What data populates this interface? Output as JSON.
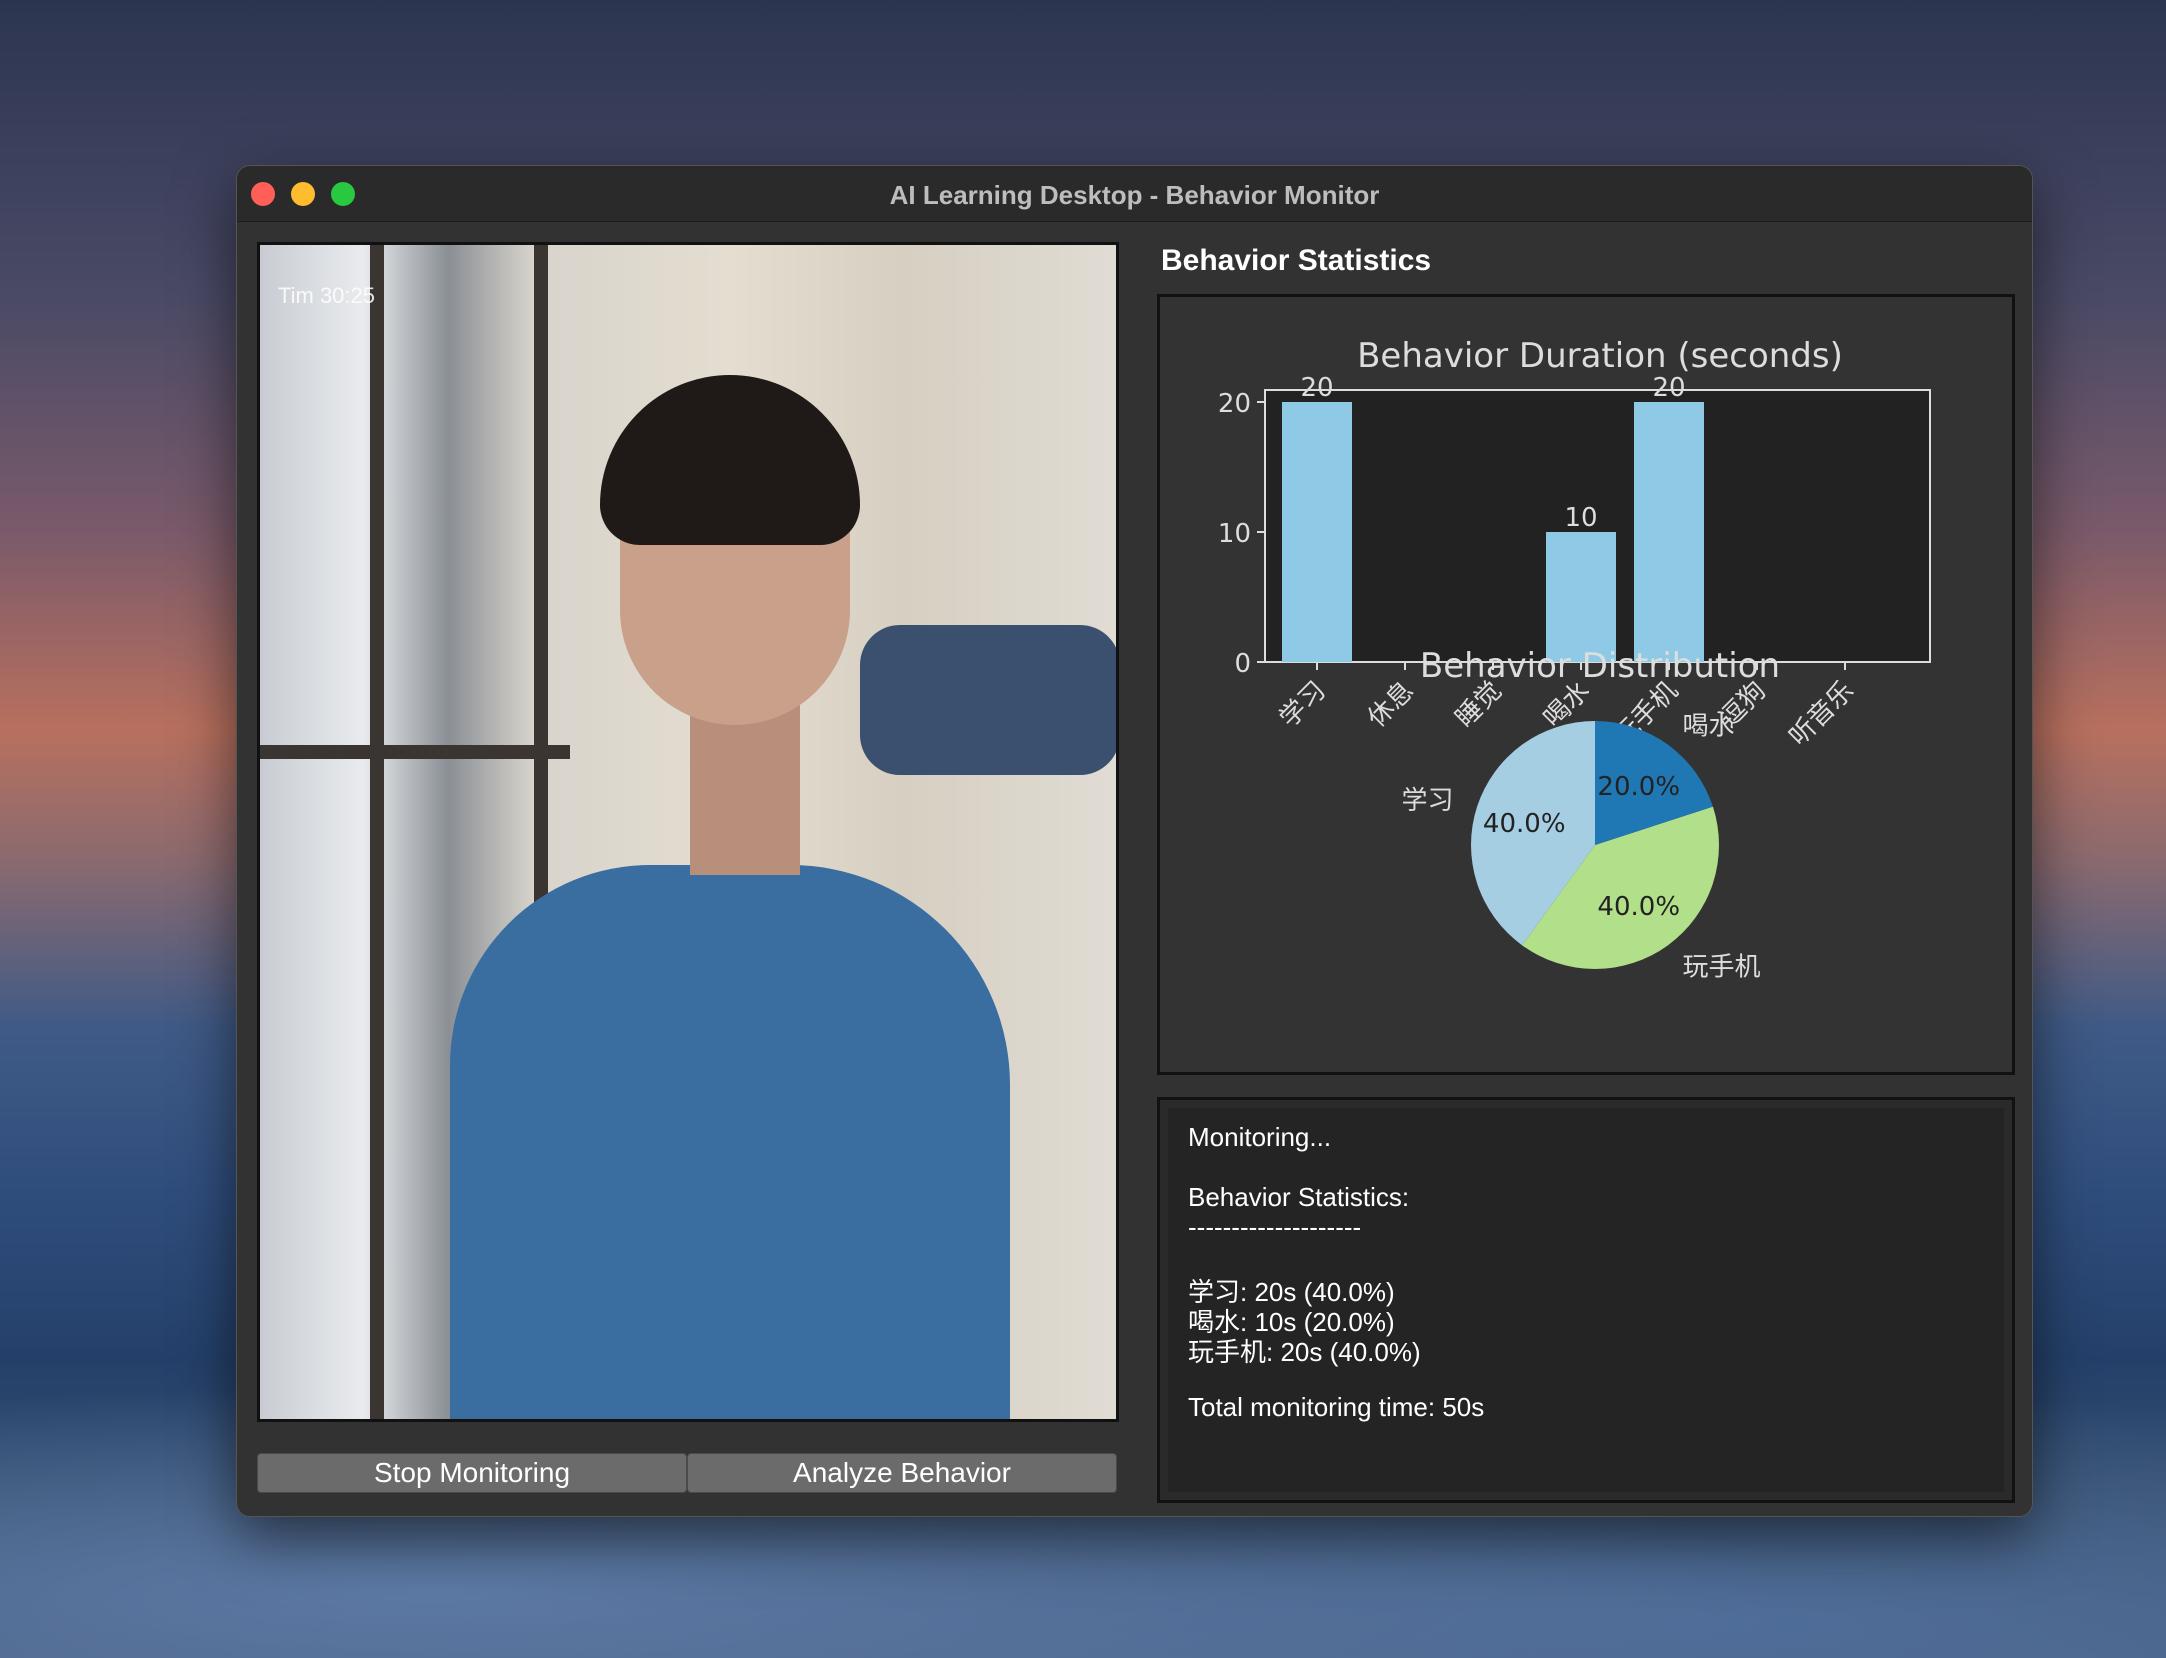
{
  "window": {
    "title": "AI Learning Desktop - Behavior Monitor"
  },
  "video": {
    "overlay_text": "Tim   30:25"
  },
  "buttons": {
    "stop": "Stop Monitoring",
    "analyze": "Analyze Behavior"
  },
  "stats_panel": {
    "title": "Behavior Statistics"
  },
  "chart_data": [
    {
      "type": "bar",
      "title": "Behavior Duration (seconds)",
      "categories": [
        "学习",
        "休息",
        "睡觉",
        "喝水",
        "玩手机",
        "逗狗",
        "听音乐"
      ],
      "values": [
        20,
        0,
        0,
        10,
        20,
        0,
        0
      ],
      "data_labels": [
        "20",
        "",
        "",
        "10",
        "20",
        "",
        ""
      ],
      "yticks": [
        "0",
        "10",
        "20"
      ],
      "ylim": [
        0,
        20
      ],
      "bar_color": "#8ecae6"
    },
    {
      "type": "pie",
      "title": "Behavior Distribution",
      "labels": [
        "学习",
        "玩手机",
        "喝水"
      ],
      "values": [
        40.0,
        40.0,
        20.0
      ],
      "pct_labels": [
        "40.0%",
        "40.0%",
        "20.0%"
      ],
      "colors": [
        "#a6cee3",
        "#b2df8a",
        "#1f78b4"
      ]
    }
  ],
  "log": {
    "lines": [
      "Monitoring...",
      "",
      "Behavior Statistics:",
      "--------------------",
      "",
      "学习: 20s (40.0%)",
      "喝水: 10s (20.0%)",
      "玩手机: 20s (40.0%)",
      "",
      "Total monitoring time: 50s"
    ]
  }
}
